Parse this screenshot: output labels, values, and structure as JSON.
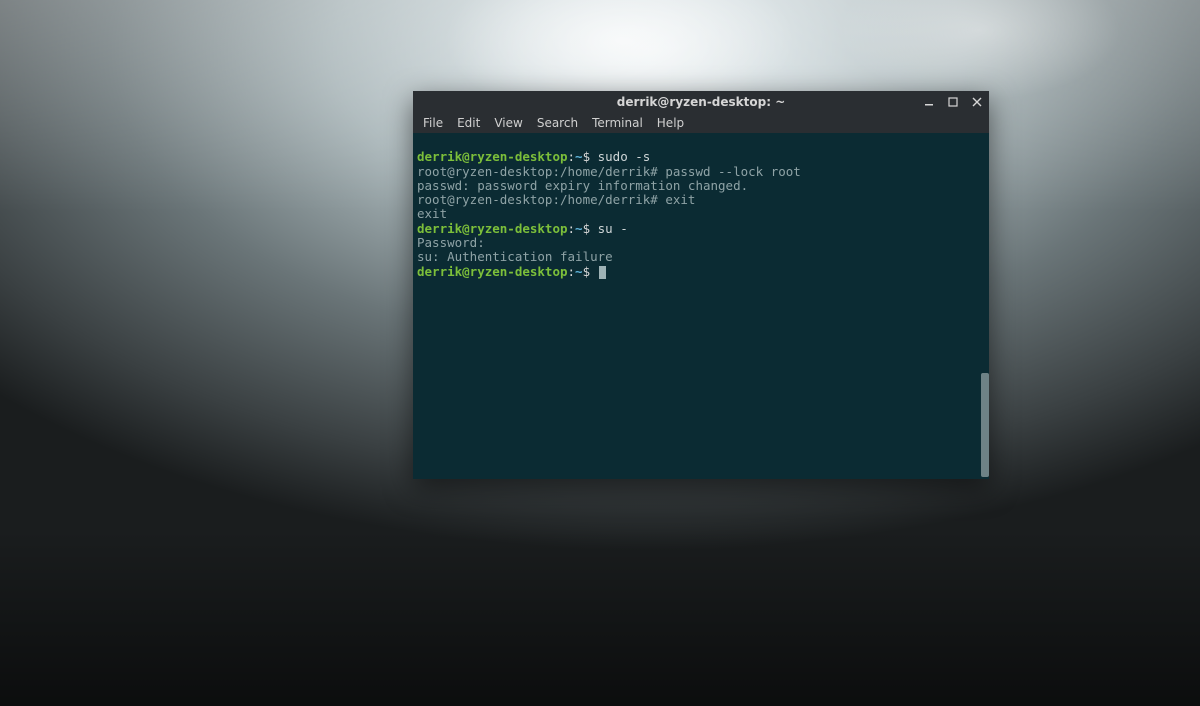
{
  "window": {
    "title": "derrik@ryzen-desktop: ~"
  },
  "menu": {
    "items": [
      "File",
      "Edit",
      "View",
      "Search",
      "Terminal",
      "Help"
    ]
  },
  "prompt": {
    "user": "derrik@ryzen-desktop",
    "sep": ":",
    "tilde": "~",
    "dollar": "$"
  },
  "lines": {
    "cmd1": " sudo -s",
    "root1": "root@ryzen-desktop:/home/derrik# passwd --lock root",
    "out1": "passwd: password expiry information changed.",
    "root2": "root@ryzen-desktop:/home/derrik# exit",
    "out2": "exit",
    "cmd2": " su -",
    "out3": "Password:",
    "out4": "su: Authentication failure"
  }
}
